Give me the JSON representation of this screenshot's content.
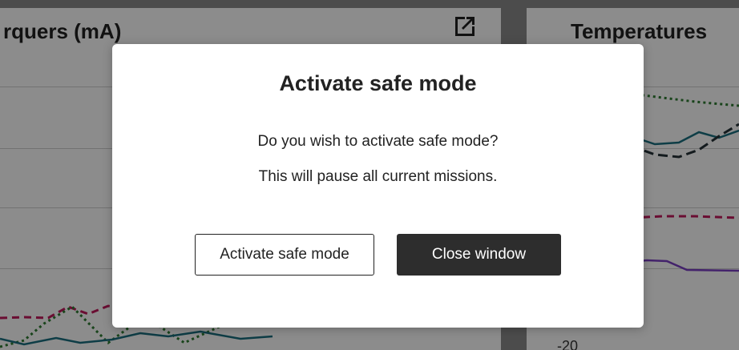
{
  "background": {
    "left_panel": {
      "title": "rquers (mA)",
      "icon": "external-link-icon"
    },
    "right_panel": {
      "title": "Temperatures",
      "tick_label": "-20"
    }
  },
  "modal": {
    "title": "Activate safe mode",
    "message_line1": "Do you wish to activate safe mode?",
    "message_line2": "This will pause all current missions.",
    "activate_label": "Activate safe mode",
    "close_label": "Close window"
  },
  "colors": {
    "overlay": "rgba(0,0,0,0.45)",
    "primary_button": "#2d2d2d",
    "series_pink": "#c2185b",
    "series_green": "#2e7d32",
    "series_teal": "#1a6f80",
    "series_dark": "#263238",
    "series_purple": "#7b3fc4"
  }
}
